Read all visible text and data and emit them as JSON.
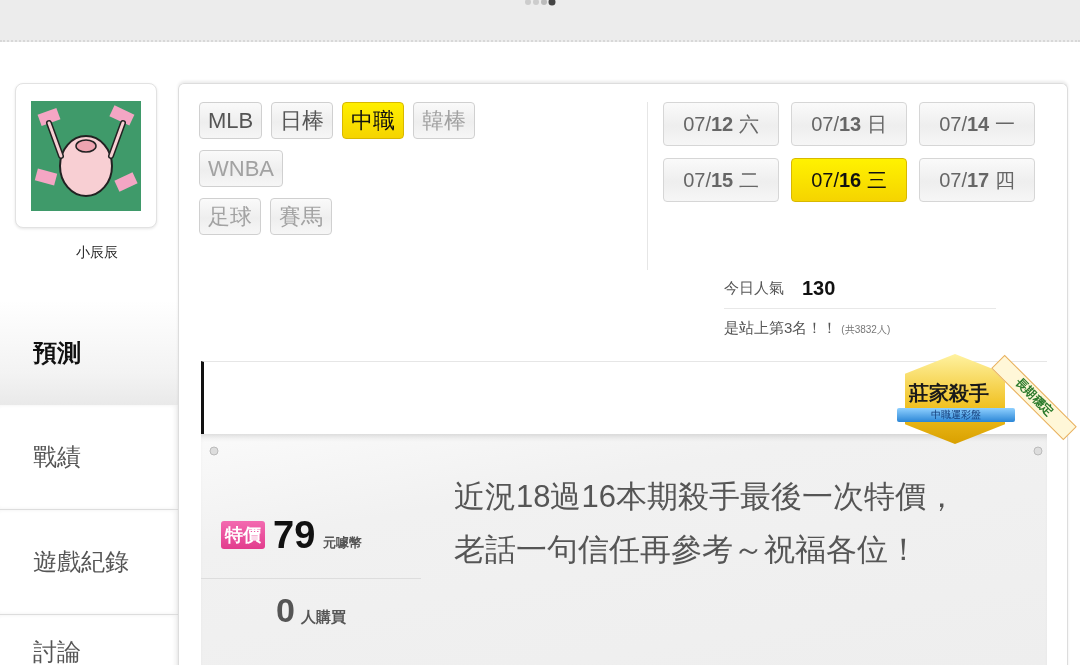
{
  "user": {
    "name": "小辰辰"
  },
  "sidebar": {
    "items": [
      {
        "label": "預測",
        "selected": true
      },
      {
        "label": "戰績",
        "selected": false
      },
      {
        "label": "遊戲紀錄",
        "selected": false
      },
      {
        "label": "討論",
        "selected": false
      }
    ]
  },
  "sport_tab_rows": [
    [
      {
        "label": "MLB",
        "selected": false,
        "disabled": false
      },
      {
        "label": "日棒",
        "selected": false,
        "disabled": false
      },
      {
        "label": "中職",
        "selected": true,
        "disabled": false
      },
      {
        "label": "韓棒",
        "selected": false,
        "disabled": true
      }
    ],
    [
      {
        "label": "WNBA",
        "selected": false,
        "disabled": true
      }
    ],
    [
      {
        "label": "足球",
        "selected": false,
        "disabled": true
      },
      {
        "label": "賽馬",
        "selected": false,
        "disabled": true
      }
    ]
  ],
  "dates": [
    {
      "label": "07/**12** 六",
      "selected": false
    },
    {
      "label": "07/**13** 日",
      "selected": false
    },
    {
      "label": "07/**14** 一",
      "selected": false
    },
    {
      "label": "07/**15** 二",
      "selected": false
    },
    {
      "label": "07/**16** 三",
      "selected": true
    },
    {
      "label": "07/**17** 四",
      "selected": false
    }
  ],
  "popularity": {
    "label": "今日人氣",
    "value": "130",
    "rank": "是站上第3名！！",
    "total": "(共3832人)"
  },
  "badge": {
    "title": "莊家殺手",
    "ribbon": "中職運彩盤",
    "sash": "長期穩定"
  },
  "offer": {
    "tag": "特價",
    "price": "79",
    "currency": "元噱幣",
    "buyers": "0",
    "buyers_unit": "人購買",
    "description": "近況18過16本期殺手最後一次特價，老話一句信任再參考～祝福各位！"
  }
}
